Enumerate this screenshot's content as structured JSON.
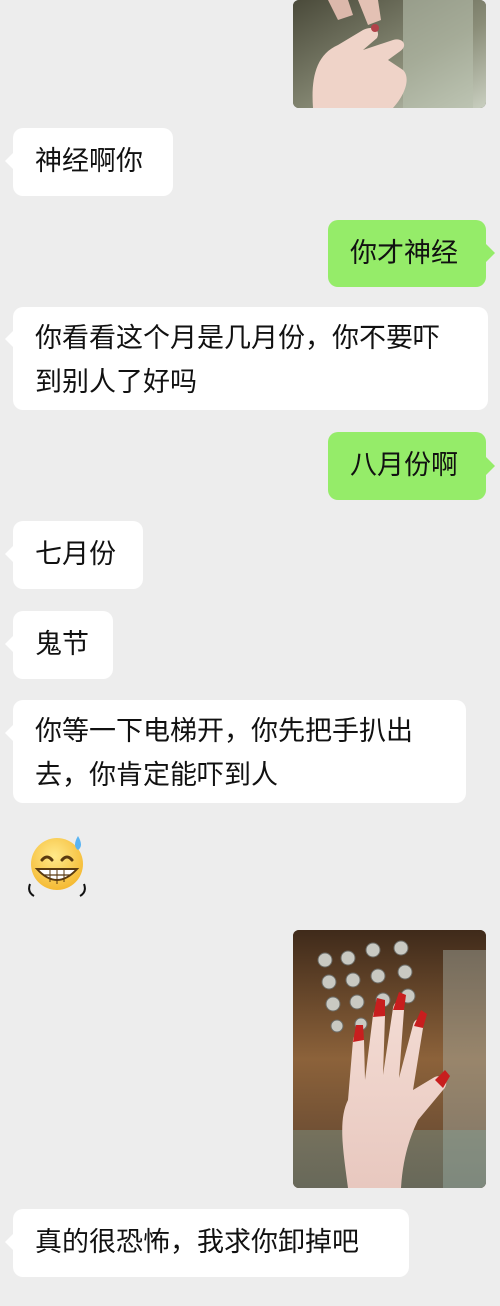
{
  "messages": [
    {
      "side": "right",
      "type": "image",
      "description_name": "photo-hand-top"
    },
    {
      "side": "left",
      "type": "text",
      "text": "神经啊你"
    },
    {
      "side": "right",
      "type": "text",
      "text": "你才神经"
    },
    {
      "side": "left",
      "type": "text",
      "lines": [
        "你看看这个月是几月份，你不要吓",
        "到别人了好吗"
      ]
    },
    {
      "side": "right",
      "type": "text",
      "text": "八月份啊"
    },
    {
      "side": "left",
      "type": "text",
      "text": "七月份"
    },
    {
      "side": "left",
      "type": "text",
      "text": "鬼节"
    },
    {
      "side": "left",
      "type": "text",
      "lines": [
        "你等一下电梯开，你先把手扒出",
        "去，你肯定能吓到人"
      ]
    },
    {
      "side": "left",
      "type": "sticker",
      "icon": "grinning-sweat-emoji"
    },
    {
      "side": "right",
      "type": "image",
      "icon": "elevator-hand-photo"
    },
    {
      "side": "left",
      "type": "text",
      "text": "真的很恐怖，我求你卸掉吧"
    }
  ],
  "colors": {
    "background": "#ededed",
    "incoming_bubble": "#ffffff",
    "outgoing_bubble": "#95ec69",
    "text": "#111111"
  }
}
